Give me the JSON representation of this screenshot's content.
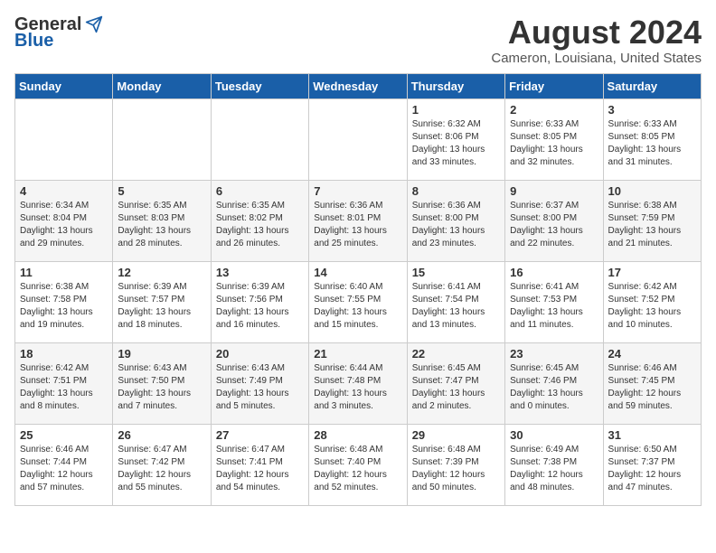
{
  "header": {
    "logo": {
      "line1": "General",
      "line2": "Blue"
    },
    "title": "August 2024",
    "subtitle": "Cameron, Louisiana, United States"
  },
  "weekdays": [
    "Sunday",
    "Monday",
    "Tuesday",
    "Wednesday",
    "Thursday",
    "Friday",
    "Saturday"
  ],
  "weeks": [
    [
      {
        "day": "",
        "info": ""
      },
      {
        "day": "",
        "info": ""
      },
      {
        "day": "",
        "info": ""
      },
      {
        "day": "",
        "info": ""
      },
      {
        "day": "1",
        "info": "Sunrise: 6:32 AM\nSunset: 8:06 PM\nDaylight: 13 hours\nand 33 minutes."
      },
      {
        "day": "2",
        "info": "Sunrise: 6:33 AM\nSunset: 8:05 PM\nDaylight: 13 hours\nand 32 minutes."
      },
      {
        "day": "3",
        "info": "Sunrise: 6:33 AM\nSunset: 8:05 PM\nDaylight: 13 hours\nand 31 minutes."
      }
    ],
    [
      {
        "day": "4",
        "info": "Sunrise: 6:34 AM\nSunset: 8:04 PM\nDaylight: 13 hours\nand 29 minutes."
      },
      {
        "day": "5",
        "info": "Sunrise: 6:35 AM\nSunset: 8:03 PM\nDaylight: 13 hours\nand 28 minutes."
      },
      {
        "day": "6",
        "info": "Sunrise: 6:35 AM\nSunset: 8:02 PM\nDaylight: 13 hours\nand 26 minutes."
      },
      {
        "day": "7",
        "info": "Sunrise: 6:36 AM\nSunset: 8:01 PM\nDaylight: 13 hours\nand 25 minutes."
      },
      {
        "day": "8",
        "info": "Sunrise: 6:36 AM\nSunset: 8:00 PM\nDaylight: 13 hours\nand 23 minutes."
      },
      {
        "day": "9",
        "info": "Sunrise: 6:37 AM\nSunset: 8:00 PM\nDaylight: 13 hours\nand 22 minutes."
      },
      {
        "day": "10",
        "info": "Sunrise: 6:38 AM\nSunset: 7:59 PM\nDaylight: 13 hours\nand 21 minutes."
      }
    ],
    [
      {
        "day": "11",
        "info": "Sunrise: 6:38 AM\nSunset: 7:58 PM\nDaylight: 13 hours\nand 19 minutes."
      },
      {
        "day": "12",
        "info": "Sunrise: 6:39 AM\nSunset: 7:57 PM\nDaylight: 13 hours\nand 18 minutes."
      },
      {
        "day": "13",
        "info": "Sunrise: 6:39 AM\nSunset: 7:56 PM\nDaylight: 13 hours\nand 16 minutes."
      },
      {
        "day": "14",
        "info": "Sunrise: 6:40 AM\nSunset: 7:55 PM\nDaylight: 13 hours\nand 15 minutes."
      },
      {
        "day": "15",
        "info": "Sunrise: 6:41 AM\nSunset: 7:54 PM\nDaylight: 13 hours\nand 13 minutes."
      },
      {
        "day": "16",
        "info": "Sunrise: 6:41 AM\nSunset: 7:53 PM\nDaylight: 13 hours\nand 11 minutes."
      },
      {
        "day": "17",
        "info": "Sunrise: 6:42 AM\nSunset: 7:52 PM\nDaylight: 13 hours\nand 10 minutes."
      }
    ],
    [
      {
        "day": "18",
        "info": "Sunrise: 6:42 AM\nSunset: 7:51 PM\nDaylight: 13 hours\nand 8 minutes."
      },
      {
        "day": "19",
        "info": "Sunrise: 6:43 AM\nSunset: 7:50 PM\nDaylight: 13 hours\nand 7 minutes."
      },
      {
        "day": "20",
        "info": "Sunrise: 6:43 AM\nSunset: 7:49 PM\nDaylight: 13 hours\nand 5 minutes."
      },
      {
        "day": "21",
        "info": "Sunrise: 6:44 AM\nSunset: 7:48 PM\nDaylight: 13 hours\nand 3 minutes."
      },
      {
        "day": "22",
        "info": "Sunrise: 6:45 AM\nSunset: 7:47 PM\nDaylight: 13 hours\nand 2 minutes."
      },
      {
        "day": "23",
        "info": "Sunrise: 6:45 AM\nSunset: 7:46 PM\nDaylight: 13 hours\nand 0 minutes."
      },
      {
        "day": "24",
        "info": "Sunrise: 6:46 AM\nSunset: 7:45 PM\nDaylight: 12 hours\nand 59 minutes."
      }
    ],
    [
      {
        "day": "25",
        "info": "Sunrise: 6:46 AM\nSunset: 7:44 PM\nDaylight: 12 hours\nand 57 minutes."
      },
      {
        "day": "26",
        "info": "Sunrise: 6:47 AM\nSunset: 7:42 PM\nDaylight: 12 hours\nand 55 minutes."
      },
      {
        "day": "27",
        "info": "Sunrise: 6:47 AM\nSunset: 7:41 PM\nDaylight: 12 hours\nand 54 minutes."
      },
      {
        "day": "28",
        "info": "Sunrise: 6:48 AM\nSunset: 7:40 PM\nDaylight: 12 hours\nand 52 minutes."
      },
      {
        "day": "29",
        "info": "Sunrise: 6:48 AM\nSunset: 7:39 PM\nDaylight: 12 hours\nand 50 minutes."
      },
      {
        "day": "30",
        "info": "Sunrise: 6:49 AM\nSunset: 7:38 PM\nDaylight: 12 hours\nand 48 minutes."
      },
      {
        "day": "31",
        "info": "Sunrise: 6:50 AM\nSunset: 7:37 PM\nDaylight: 12 hours\nand 47 minutes."
      }
    ]
  ]
}
